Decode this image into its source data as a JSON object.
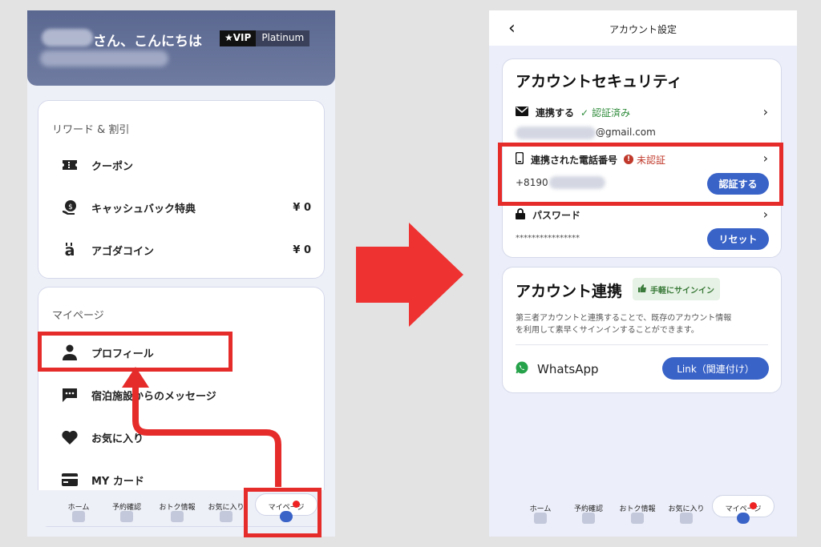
{
  "left": {
    "greeting": "さん、こんにちは",
    "vip_badge": "★VIP",
    "vip_tier": "Platinum",
    "rewards": {
      "title": "リワード & 割引",
      "items": [
        {
          "label": "クーポン",
          "value": "",
          "icon": "coupon-icon"
        },
        {
          "label": "キャッシュバック特典",
          "value": "¥ 0",
          "icon": "cashback-icon"
        },
        {
          "label": "アゴダコイン",
          "value": "¥ 0",
          "icon": "coin-icon"
        }
      ]
    },
    "mypage": {
      "title": "マイページ",
      "items": [
        {
          "label": "プロフィール",
          "icon": "person-icon"
        },
        {
          "label": "宿泊施設からのメッセージ",
          "icon": "chat-icon"
        },
        {
          "label": "お気に入り",
          "icon": "heart-icon"
        },
        {
          "label": "MY カード",
          "icon": "card-icon"
        }
      ]
    },
    "nav": [
      "ホーム",
      "予約確認",
      "おトク情報",
      "お気に入り",
      "マイページ"
    ]
  },
  "right": {
    "header_title": "アカウント設定",
    "security": {
      "title": "アカウントセキュリティ",
      "email_label": "連携する",
      "email_status": "認証済み",
      "email_value": "@gmail.com",
      "phone_label": "連携された電話番号",
      "phone_status": "未認証",
      "phone_value": "+8190",
      "verify_button": "認証する",
      "password_label": "パスワード",
      "password_value": "****************",
      "reset_button": "リセット"
    },
    "linking": {
      "title": "アカウント連携",
      "badge": "手軽にサインイン",
      "description_line1": "第三者アカウントと連携することで、既存のアカウント情報",
      "description_line2": "を利用して素早くサインインすることができます。",
      "whatsapp_label": "WhatsApp",
      "link_button": "Link（関連付け）"
    },
    "nav": [
      "ホーム",
      "予約確認",
      "おトク情報",
      "お気に入り",
      "マイページ"
    ]
  },
  "colors": {
    "accent": "#3a63c8",
    "highlight": "#e62b2b",
    "verified": "#2e8b3a",
    "unverified": "#c0392b"
  }
}
